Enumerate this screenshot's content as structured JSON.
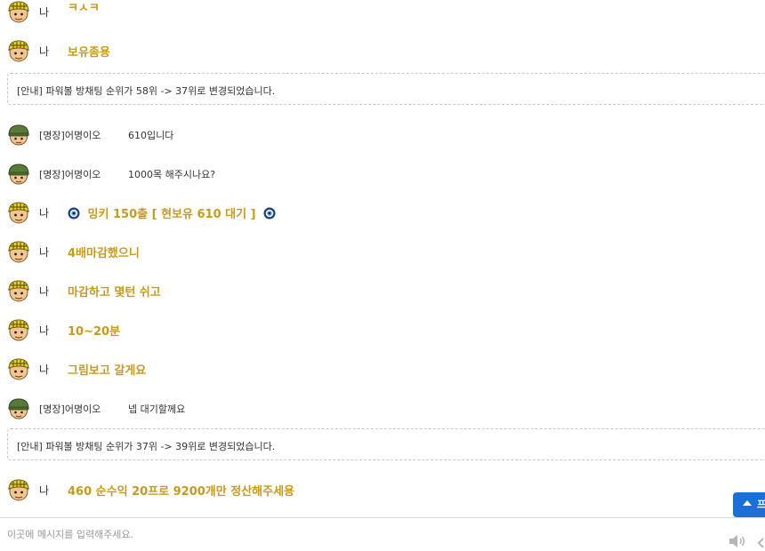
{
  "messages": [
    {
      "kind": "me",
      "name": "나",
      "text": "ㅋㅅㅋ"
    },
    {
      "kind": "me",
      "name": "나",
      "text": "보유좀용"
    },
    {
      "kind": "notice",
      "text": "[안내] 파워볼 방채팅 순위가 58위 -> 37위로 변경되었습니다."
    },
    {
      "kind": "other",
      "name": "[명장]어명이오",
      "text": "610입니다"
    },
    {
      "kind": "other",
      "name": "[명장]어명이오",
      "text": "1000목 해주시나요?"
    },
    {
      "kind": "me-eye",
      "name": "나",
      "text": "밍키 150출 [ 현보유 610 대기 ]"
    },
    {
      "kind": "me",
      "name": "나",
      "text": "4배마감했으니"
    },
    {
      "kind": "me",
      "name": "나",
      "text": "마감하고 몇턴 쉬고"
    },
    {
      "kind": "me",
      "name": "나",
      "text": "10~20분"
    },
    {
      "kind": "me",
      "name": "나",
      "text": "그림보고 갈게요"
    },
    {
      "kind": "other",
      "name": "[명장]어명이오",
      "text": "넵 대기할께요"
    },
    {
      "kind": "notice",
      "text": "[안내] 파워볼 방채팅 순위가 37위 -> 39위로 변경되었습니다."
    },
    {
      "kind": "me",
      "name": "나",
      "text": "460 순수익 20프로 9200개만 정산해주세용"
    }
  ],
  "input": {
    "placeholder": "이곳에 메시지를 입력해주세요."
  },
  "scroll_top": {
    "label": "프"
  },
  "icons": {
    "me_avatar": "yellow-helmet-avatar-icon",
    "other_avatar": "green-helmet-soldier-avatar-icon",
    "eye": "nazar-eye-icon",
    "speaker": "speaker-icon",
    "back": "chevron-left-icon"
  },
  "colors": {
    "me_text": "#c79a1d",
    "other_text": "#333333",
    "scroll_button": "#1d6fd8"
  }
}
